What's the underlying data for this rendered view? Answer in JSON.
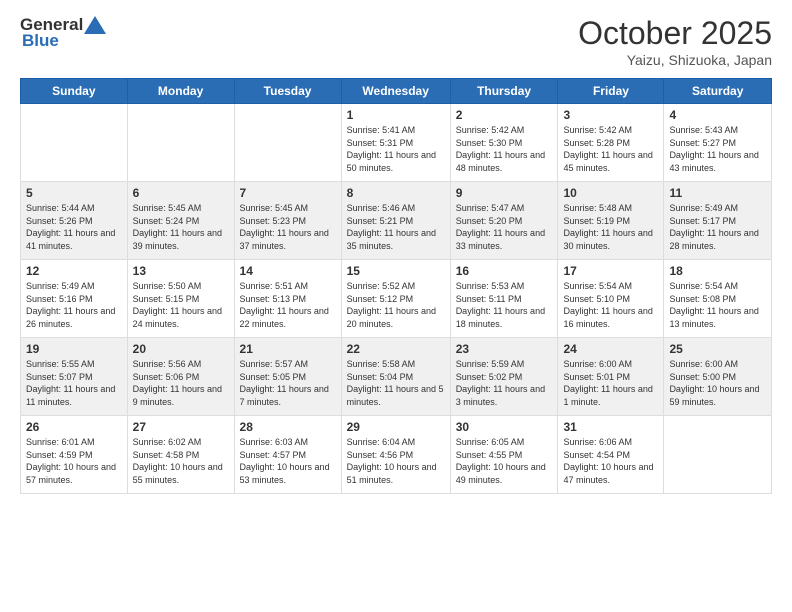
{
  "header": {
    "logo_general": "General",
    "logo_blue": "Blue",
    "month_title": "October 2025",
    "location": "Yaizu, Shizuoka, Japan"
  },
  "days_of_week": [
    "Sunday",
    "Monday",
    "Tuesday",
    "Wednesday",
    "Thursday",
    "Friday",
    "Saturday"
  ],
  "weeks": [
    [
      {
        "day": "",
        "empty": true
      },
      {
        "day": "",
        "empty": true
      },
      {
        "day": "",
        "empty": true
      },
      {
        "day": "1",
        "sunrise": "Sunrise: 5:41 AM",
        "sunset": "Sunset: 5:31 PM",
        "daylight": "Daylight: 11 hours and 50 minutes."
      },
      {
        "day": "2",
        "sunrise": "Sunrise: 5:42 AM",
        "sunset": "Sunset: 5:30 PM",
        "daylight": "Daylight: 11 hours and 48 minutes."
      },
      {
        "day": "3",
        "sunrise": "Sunrise: 5:42 AM",
        "sunset": "Sunset: 5:28 PM",
        "daylight": "Daylight: 11 hours and 45 minutes."
      },
      {
        "day": "4",
        "sunrise": "Sunrise: 5:43 AM",
        "sunset": "Sunset: 5:27 PM",
        "daylight": "Daylight: 11 hours and 43 minutes."
      }
    ],
    [
      {
        "day": "5",
        "sunrise": "Sunrise: 5:44 AM",
        "sunset": "Sunset: 5:26 PM",
        "daylight": "Daylight: 11 hours and 41 minutes."
      },
      {
        "day": "6",
        "sunrise": "Sunrise: 5:45 AM",
        "sunset": "Sunset: 5:24 PM",
        "daylight": "Daylight: 11 hours and 39 minutes."
      },
      {
        "day": "7",
        "sunrise": "Sunrise: 5:45 AM",
        "sunset": "Sunset: 5:23 PM",
        "daylight": "Daylight: 11 hours and 37 minutes."
      },
      {
        "day": "8",
        "sunrise": "Sunrise: 5:46 AM",
        "sunset": "Sunset: 5:21 PM",
        "daylight": "Daylight: 11 hours and 35 minutes."
      },
      {
        "day": "9",
        "sunrise": "Sunrise: 5:47 AM",
        "sunset": "Sunset: 5:20 PM",
        "daylight": "Daylight: 11 hours and 33 minutes."
      },
      {
        "day": "10",
        "sunrise": "Sunrise: 5:48 AM",
        "sunset": "Sunset: 5:19 PM",
        "daylight": "Daylight: 11 hours and 30 minutes."
      },
      {
        "day": "11",
        "sunrise": "Sunrise: 5:49 AM",
        "sunset": "Sunset: 5:17 PM",
        "daylight": "Daylight: 11 hours and 28 minutes."
      }
    ],
    [
      {
        "day": "12",
        "sunrise": "Sunrise: 5:49 AM",
        "sunset": "Sunset: 5:16 PM",
        "daylight": "Daylight: 11 hours and 26 minutes."
      },
      {
        "day": "13",
        "sunrise": "Sunrise: 5:50 AM",
        "sunset": "Sunset: 5:15 PM",
        "daylight": "Daylight: 11 hours and 24 minutes."
      },
      {
        "day": "14",
        "sunrise": "Sunrise: 5:51 AM",
        "sunset": "Sunset: 5:13 PM",
        "daylight": "Daylight: 11 hours and 22 minutes."
      },
      {
        "day": "15",
        "sunrise": "Sunrise: 5:52 AM",
        "sunset": "Sunset: 5:12 PM",
        "daylight": "Daylight: 11 hours and 20 minutes."
      },
      {
        "day": "16",
        "sunrise": "Sunrise: 5:53 AM",
        "sunset": "Sunset: 5:11 PM",
        "daylight": "Daylight: 11 hours and 18 minutes."
      },
      {
        "day": "17",
        "sunrise": "Sunrise: 5:54 AM",
        "sunset": "Sunset: 5:10 PM",
        "daylight": "Daylight: 11 hours and 16 minutes."
      },
      {
        "day": "18",
        "sunrise": "Sunrise: 5:54 AM",
        "sunset": "Sunset: 5:08 PM",
        "daylight": "Daylight: 11 hours and 13 minutes."
      }
    ],
    [
      {
        "day": "19",
        "sunrise": "Sunrise: 5:55 AM",
        "sunset": "Sunset: 5:07 PM",
        "daylight": "Daylight: 11 hours and 11 minutes."
      },
      {
        "day": "20",
        "sunrise": "Sunrise: 5:56 AM",
        "sunset": "Sunset: 5:06 PM",
        "daylight": "Daylight: 11 hours and 9 minutes."
      },
      {
        "day": "21",
        "sunrise": "Sunrise: 5:57 AM",
        "sunset": "Sunset: 5:05 PM",
        "daylight": "Daylight: 11 hours and 7 minutes."
      },
      {
        "day": "22",
        "sunrise": "Sunrise: 5:58 AM",
        "sunset": "Sunset: 5:04 PM",
        "daylight": "Daylight: 11 hours and 5 minutes."
      },
      {
        "day": "23",
        "sunrise": "Sunrise: 5:59 AM",
        "sunset": "Sunset: 5:02 PM",
        "daylight": "Daylight: 11 hours and 3 minutes."
      },
      {
        "day": "24",
        "sunrise": "Sunrise: 6:00 AM",
        "sunset": "Sunset: 5:01 PM",
        "daylight": "Daylight: 11 hours and 1 minute."
      },
      {
        "day": "25",
        "sunrise": "Sunrise: 6:00 AM",
        "sunset": "Sunset: 5:00 PM",
        "daylight": "Daylight: 10 hours and 59 minutes."
      }
    ],
    [
      {
        "day": "26",
        "sunrise": "Sunrise: 6:01 AM",
        "sunset": "Sunset: 4:59 PM",
        "daylight": "Daylight: 10 hours and 57 minutes."
      },
      {
        "day": "27",
        "sunrise": "Sunrise: 6:02 AM",
        "sunset": "Sunset: 4:58 PM",
        "daylight": "Daylight: 10 hours and 55 minutes."
      },
      {
        "day": "28",
        "sunrise": "Sunrise: 6:03 AM",
        "sunset": "Sunset: 4:57 PM",
        "daylight": "Daylight: 10 hours and 53 minutes."
      },
      {
        "day": "29",
        "sunrise": "Sunrise: 6:04 AM",
        "sunset": "Sunset: 4:56 PM",
        "daylight": "Daylight: 10 hours and 51 minutes."
      },
      {
        "day": "30",
        "sunrise": "Sunrise: 6:05 AM",
        "sunset": "Sunset: 4:55 PM",
        "daylight": "Daylight: 10 hours and 49 minutes."
      },
      {
        "day": "31",
        "sunrise": "Sunrise: 6:06 AM",
        "sunset": "Sunset: 4:54 PM",
        "daylight": "Daylight: 10 hours and 47 minutes."
      },
      {
        "day": "",
        "empty": true
      }
    ]
  ]
}
